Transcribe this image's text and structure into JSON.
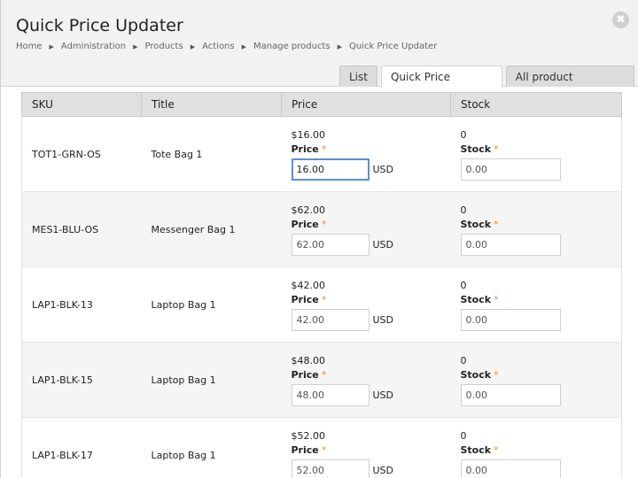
{
  "header": {
    "title": "Quick Price Updater",
    "breadcrumb": [
      "Home",
      "Administration",
      "Products",
      "Actions",
      "Manage products",
      "Quick Price Updater"
    ]
  },
  "tabs": [
    {
      "label": "List",
      "active": false
    },
    {
      "label": "Quick Price Updater",
      "active": true
    },
    {
      "label": "All product variations",
      "active": false
    }
  ],
  "table": {
    "columns": [
      "SKU",
      "Title",
      "Price",
      "Stock"
    ],
    "price_label": "Price",
    "stock_label": "Stock",
    "required_mark": "*",
    "currency": "USD",
    "rows": [
      {
        "sku": "TOT1-GRN-OS",
        "title": "Tote Bag 1",
        "current_price": "$16.00",
        "price_value": "16.00",
        "current_stock": "0",
        "stock_value": "0.00"
      },
      {
        "sku": "MES1-BLU-OS",
        "title": "Messenger Bag 1",
        "current_price": "$62.00",
        "price_value": "62.00",
        "current_stock": "0",
        "stock_value": "0.00"
      },
      {
        "sku": "LAP1-BLK-13",
        "title": "Laptop Bag 1",
        "current_price": "$42.00",
        "price_value": "42.00",
        "current_stock": "0",
        "stock_value": "0.00"
      },
      {
        "sku": "LAP1-BLK-15",
        "title": "Laptop Bag 1",
        "current_price": "$48.00",
        "price_value": "48.00",
        "current_stock": "0",
        "stock_value": "0.00"
      },
      {
        "sku": "LAP1-BLK-17",
        "title": "Laptop Bag 1",
        "current_price": "$52.00",
        "price_value": "52.00",
        "current_stock": "0",
        "stock_value": "0.00"
      }
    ]
  },
  "colors": {
    "required": "#e8903a",
    "focus": "#5b8fd1"
  }
}
